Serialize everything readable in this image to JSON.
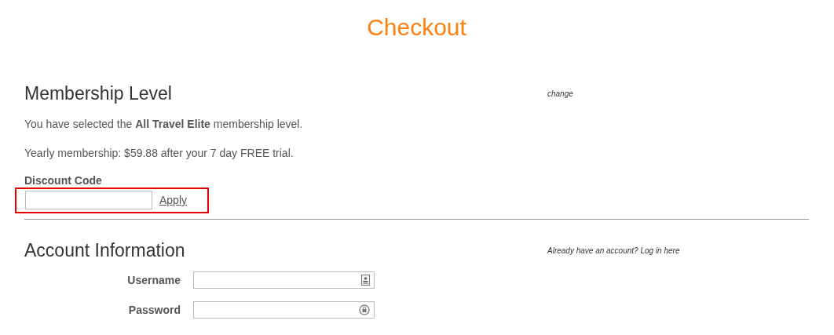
{
  "page_title": "Checkout",
  "membership": {
    "heading": "Membership Level",
    "change_link": "change",
    "selected_text": "You have selected the **All Travel Elite** membership level.",
    "pricing_text": "Yearly membership: $59.88 after your 7 day FREE trial.",
    "discount": {
      "label": "Discount Code",
      "apply": "Apply",
      "highlighted": true
    }
  },
  "account": {
    "heading": "Account Information",
    "login_link": "Already have an account? Log in here",
    "fields": [
      {
        "label": "Username",
        "kind": "contact"
      },
      {
        "label": "Password",
        "kind": "lock"
      }
    ]
  }
}
